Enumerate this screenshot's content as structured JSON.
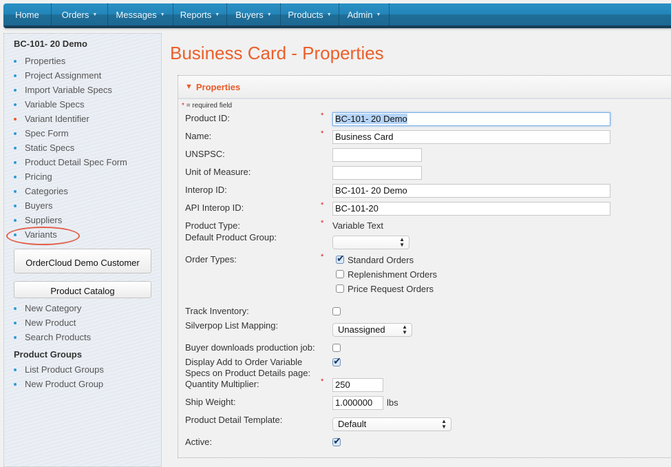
{
  "nav": {
    "items": [
      {
        "label": "Home",
        "has_dropdown": false
      },
      {
        "label": "Orders",
        "has_dropdown": true
      },
      {
        "label": "Messages",
        "has_dropdown": true
      },
      {
        "label": "Reports",
        "has_dropdown": true
      },
      {
        "label": "Buyers",
        "has_dropdown": true
      },
      {
        "label": "Products",
        "has_dropdown": true
      },
      {
        "label": "Admin",
        "has_dropdown": true
      }
    ],
    "caret": "▼"
  },
  "sidebar": {
    "title": "BC-101- 20 Demo",
    "items": [
      {
        "label": "Properties"
      },
      {
        "label": "Project Assignment"
      },
      {
        "label": "Import Variable Specs"
      },
      {
        "label": "Variable Specs"
      },
      {
        "label": "Variant Identifier",
        "active": true
      },
      {
        "label": "Spec Form"
      },
      {
        "label": "Static Specs"
      },
      {
        "label": "Product Detail Spec Form"
      },
      {
        "label": "Pricing"
      },
      {
        "label": "Categories"
      },
      {
        "label": "Buyers"
      },
      {
        "label": "Suppliers"
      },
      {
        "label": "Variants",
        "annotated": true
      }
    ],
    "customer_button": "OrderCloud Demo Customer",
    "catalog_button": "Product Catalog",
    "catalog_items": [
      {
        "label": "New Category"
      },
      {
        "label": "New Product"
      },
      {
        "label": "Search Products"
      }
    ],
    "groups_title": "Product Groups",
    "group_items": [
      {
        "label": "List Product Groups"
      },
      {
        "label": "New Product Group"
      }
    ]
  },
  "page": {
    "title": "Business Card - Properties"
  },
  "panel": {
    "header": "Properties",
    "header_icon": "▼",
    "required_note": "= required field",
    "required_star": "*",
    "fields": {
      "product_id": {
        "label": "Product ID:",
        "value": "BC-101- 20 Demo",
        "required": true
      },
      "name": {
        "label": "Name:",
        "value": "Business Card",
        "required": true
      },
      "unspsc": {
        "label": "UNSPSC:",
        "value": ""
      },
      "unit_of_measure": {
        "label": "Unit of Measure:",
        "value": ""
      },
      "interop_id": {
        "label": "Interop ID:",
        "value": "BC-101- 20 Demo"
      },
      "api_interop_id": {
        "label": "API Interop ID:",
        "value": "BC-101-20",
        "required": true
      },
      "product_type": {
        "label": "Product Type:",
        "value": "Variable Text",
        "required": true
      },
      "default_product_group": {
        "label": "Default Product Group:",
        "value": ""
      },
      "order_types": {
        "label": "Order Types:",
        "required": true,
        "options": [
          {
            "label": "Standard Orders",
            "checked": true
          },
          {
            "label": "Replenishment Orders",
            "checked": false
          },
          {
            "label": "Price Request Orders",
            "checked": false
          }
        ]
      },
      "track_inventory": {
        "label": "Track Inventory:",
        "checked": false
      },
      "silverpop": {
        "label": "Silverpop List Mapping:",
        "value": "Unassigned"
      },
      "buyer_downloads": {
        "label": "Buyer downloads production job:",
        "checked": false
      },
      "display_add_to_order": {
        "label_line1": "Display Add to Order Variable",
        "label_line2": "Specs on Product Details page:",
        "checked": true
      },
      "quantity_multiplier": {
        "label": "Quantity Multiplier:",
        "value": "250",
        "required": true
      },
      "ship_weight": {
        "label": "Ship Weight:",
        "value": "1.000000",
        "unit": "lbs"
      },
      "product_detail_template": {
        "label": "Product Detail Template:",
        "value": "Default"
      },
      "active": {
        "label": "Active:",
        "checked": true
      }
    }
  },
  "colors": {
    "nav_blue": "#2386ba",
    "accent_orange": "#ec5f2a",
    "bullet_blue": "#2a9ad6",
    "required_red": "#e21a1a"
  }
}
